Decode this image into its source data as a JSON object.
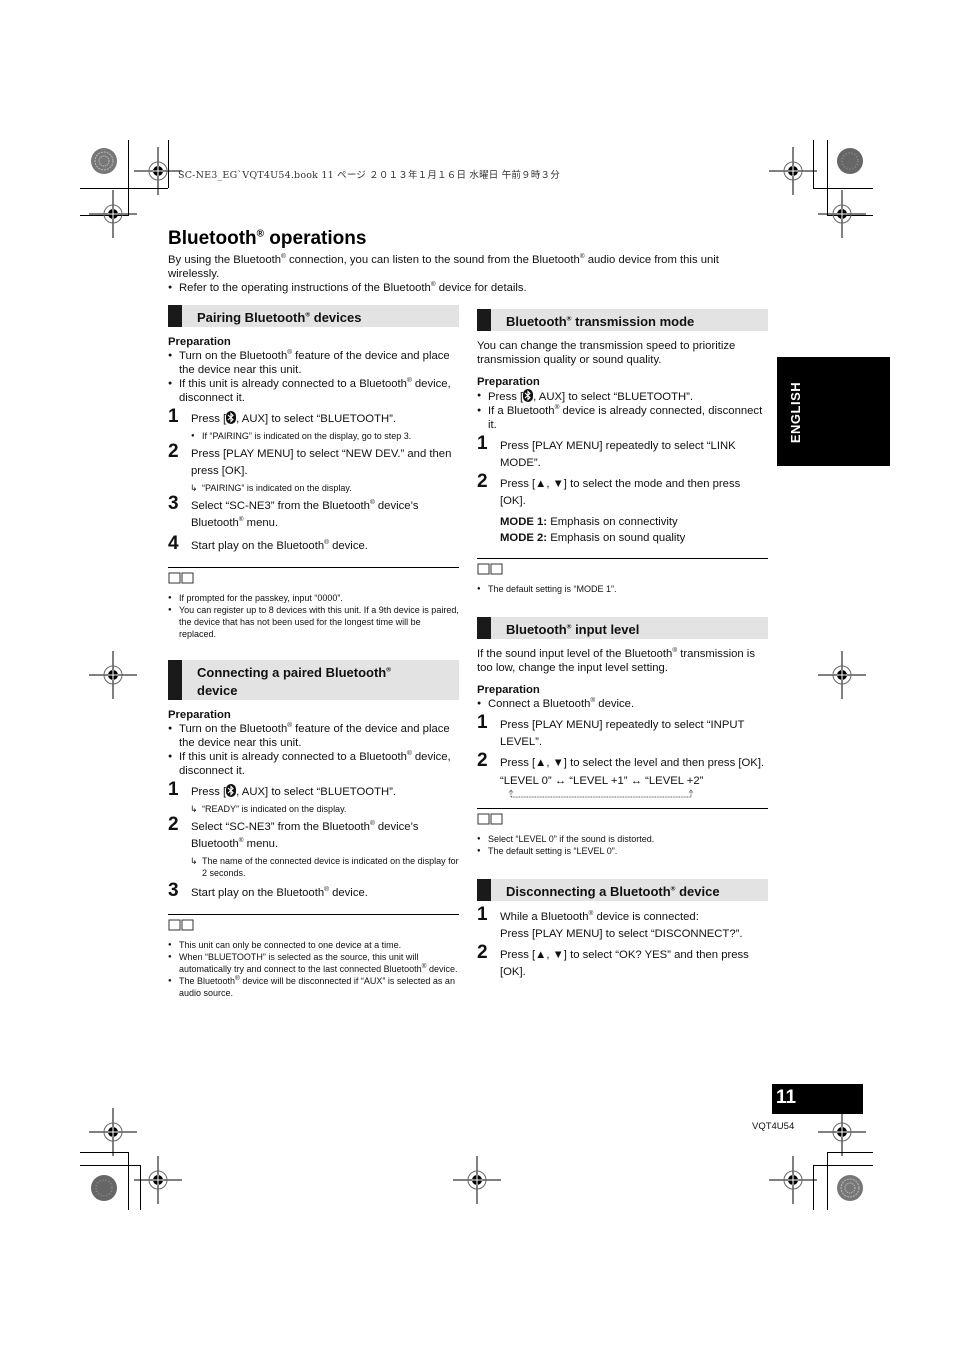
{
  "header_stamp": "SC-NE3_EG`VQT4U54.book  11 ページ  ２０１３年１月１６日  水曜日  午前９時３分",
  "title": {
    "text": "Bluetooth",
    "reg": "®",
    "rest": " operations"
  },
  "intro": {
    "line1_a": "By using the Bluetooth",
    "line1_b": " connection, you can listen to the sound from the Bluetooth",
    "line1_c": " audio device from this unit wirelessly.",
    "bullet_a": "Refer to the operating instructions of the Bluetooth",
    "bullet_b": " device for details."
  },
  "reg": "®",
  "side_tab": "ENGLISH",
  "page_number": "11",
  "doc_code": "VQT4U54",
  "icons": {
    "bluetooth": "bluetooth-icon",
    "note": "note-book-icon",
    "registration": "registration-mark-icon",
    "color_bar": "color-target-icon"
  },
  "sections": {
    "pairing": {
      "title_a": "Pairing Bluetooth",
      "title_b": " devices",
      "prep_label": "Preparation",
      "prep1_a": "Turn on the Bluetooth",
      "prep1_b": " feature of the device and place the device near this unit.",
      "prep2_a": "If this unit is already connected to a Bluetooth",
      "prep2_b": " device, disconnect it.",
      "step1_a": "Press [",
      "step1_b": ", AUX] to select “BLUETOOTH”.",
      "step1_sub": "If “PAIRING” is indicated on the display, go to step 3.",
      "step2": "Press [PLAY MENU] to select “NEW DEV.” and then press [OK].",
      "step2_sub": "“PAIRING” is indicated on the display.",
      "step3_a": "Select “SC-NE3” from the Bluetooth",
      "step3_b": " device’s Bluetooth",
      "step3_c": " menu.",
      "step4_a": "Start play on the Bluetooth",
      "step4_b": " device.",
      "notes": [
        "If prompted for the passkey, input “0000”.",
        "You can register up to 8 devices with this unit. If a 9th device is paired, the device that has not been used for the longest time will be replaced."
      ]
    },
    "connecting": {
      "title_a": "Connecting a paired Bluetooth",
      "title_b": "device",
      "prep_label": "Preparation",
      "prep1_a": "Turn on the Bluetooth",
      "prep1_b": " feature of the device and place the device near this unit.",
      "prep2_a": "If this unit is already connected to a Bluetooth",
      "prep2_b": " device, disconnect it.",
      "step1_a": "Press [",
      "step1_b": ", AUX] to select “BLUETOOTH”.",
      "step1_sub": "“READY” is indicated on the display.",
      "step2_a": "Select “SC-NE3” from the Bluetooth",
      "step2_b": " device’s Bluetooth",
      "step2_c": " menu.",
      "step2_sub": "The name of the connected device is indicated on the display for 2 seconds.",
      "step3_a": "Start play on the Bluetooth",
      "step3_b": " device.",
      "note1": "This unit can only be connected to one device at a time.",
      "note2_a": "When “BLUETOOTH” is selected as the source, this unit will automatically try and connect to the last connected Bluetooth",
      "note2_b": " device.",
      "note3_a": "The Bluetooth",
      "note3_b": " device will be disconnected if “AUX” is selected as an audio source."
    },
    "transmission": {
      "title_a": "Bluetooth",
      "title_b": " transmission mode",
      "desc": "You can change the transmission speed to prioritize transmission quality or sound quality.",
      "prep_label": "Preparation",
      "prep1_a": "Press [",
      "prep1_b": ", AUX] to select “BLUETOOTH”.",
      "prep2_a": "If a Bluetooth",
      "prep2_b": " device is already connected, disconnect it.",
      "step1": "Press [PLAY MENU] repeatedly to select “LINK MODE”.",
      "step2": "Press [▲, ▼] to select the mode and then press [OK].",
      "mode1_label": "MODE 1:",
      "mode1_text": " Emphasis on connectivity",
      "mode2_label": "MODE 2:",
      "mode2_text": " Emphasis on sound quality",
      "note": "The default setting is “MODE 1”."
    },
    "input_level": {
      "title_a": "Bluetooth",
      "title_b": " input level",
      "desc_a": "If the sound input level of the Bluetooth",
      "desc_b": " transmission is too low, change the input level setting.",
      "prep_label": "Preparation",
      "prep1_a": "Connect a Bluetooth",
      "prep1_b": " device.",
      "step1": "Press [PLAY MENU] repeatedly to select “INPUT LEVEL”.",
      "step2": "Press [▲, ▼] to select the level and then press [OK].",
      "cycle": "“LEVEL 0” ↔ “LEVEL +1” ↔ “LEVEL +2”",
      "notes": [
        "Select “LEVEL 0” if the sound is distorted.",
        "The default setting is “LEVEL 0”."
      ]
    },
    "disconnecting": {
      "title_a": "Disconnecting a Bluetooth",
      "title_b": " device",
      "step1_a": "While a Bluetooth",
      "step1_b": " device is connected:",
      "step1_line2": "Press [PLAY MENU] to select “DISCONNECT?”.",
      "step2": "Press [▲, ▼] to select “OK? YES” and then press [OK]."
    }
  }
}
